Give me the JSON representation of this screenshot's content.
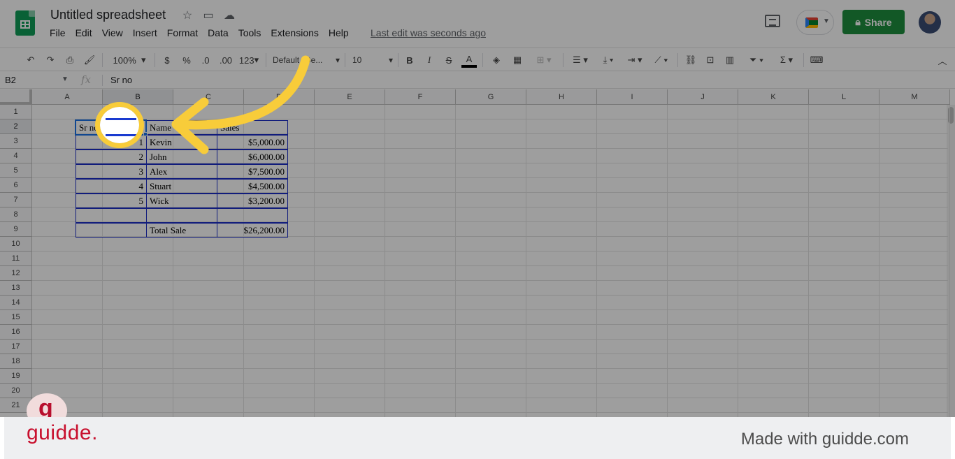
{
  "app": {
    "doc_title": "Untitled spreadsheet",
    "menu": [
      "File",
      "Edit",
      "View",
      "Insert",
      "Format",
      "Data",
      "Tools",
      "Extensions",
      "Help"
    ],
    "last_edit": "Last edit was seconds ago",
    "share_label": "Share",
    "brand_color": "#1e8e3e"
  },
  "toolbar": {
    "zoom": "100%",
    "currency": "$",
    "percent": "%",
    "dec_less": ".0",
    "dec_more": ".00",
    "format_more": "123",
    "font": "Default (Ge...",
    "font_size": "10",
    "bold": "B",
    "italic": "I",
    "strike": "S",
    "text_color": "A"
  },
  "formula_bar": {
    "name_box": "B2",
    "fx": "fx",
    "value": "Sr no"
  },
  "grid": {
    "columns": [
      "A",
      "B",
      "C",
      "D",
      "E",
      "F",
      "G",
      "H",
      "I",
      "J",
      "K",
      "L",
      "M"
    ],
    "rows": [
      "1",
      "2",
      "3",
      "4",
      "5",
      "6",
      "7",
      "8",
      "9",
      "10",
      "11",
      "12",
      "13",
      "14",
      "15",
      "16",
      "17",
      "18",
      "19",
      "20",
      "21"
    ],
    "headers": [
      "Sr no",
      "Name",
      "Sales"
    ],
    "data": [
      [
        "1",
        "Kevin",
        "$5,000.00"
      ],
      [
        "2",
        "John",
        "$6,000.00"
      ],
      [
        "3",
        "Alex",
        "$7,500.00"
      ],
      [
        "4",
        "Stuart",
        "$4,500.00"
      ],
      [
        "5",
        "Wick",
        "$3,200.00"
      ],
      [
        "",
        "",
        ""
      ],
      [
        "",
        "Total Sale",
        "$26,200.00"
      ]
    ]
  },
  "footer": {
    "logo": "guidde.",
    "made_with": "Made with guidde.com",
    "badge": "g",
    "brand_color": "#c8102e"
  },
  "highlight_color": "#f8cc3a"
}
